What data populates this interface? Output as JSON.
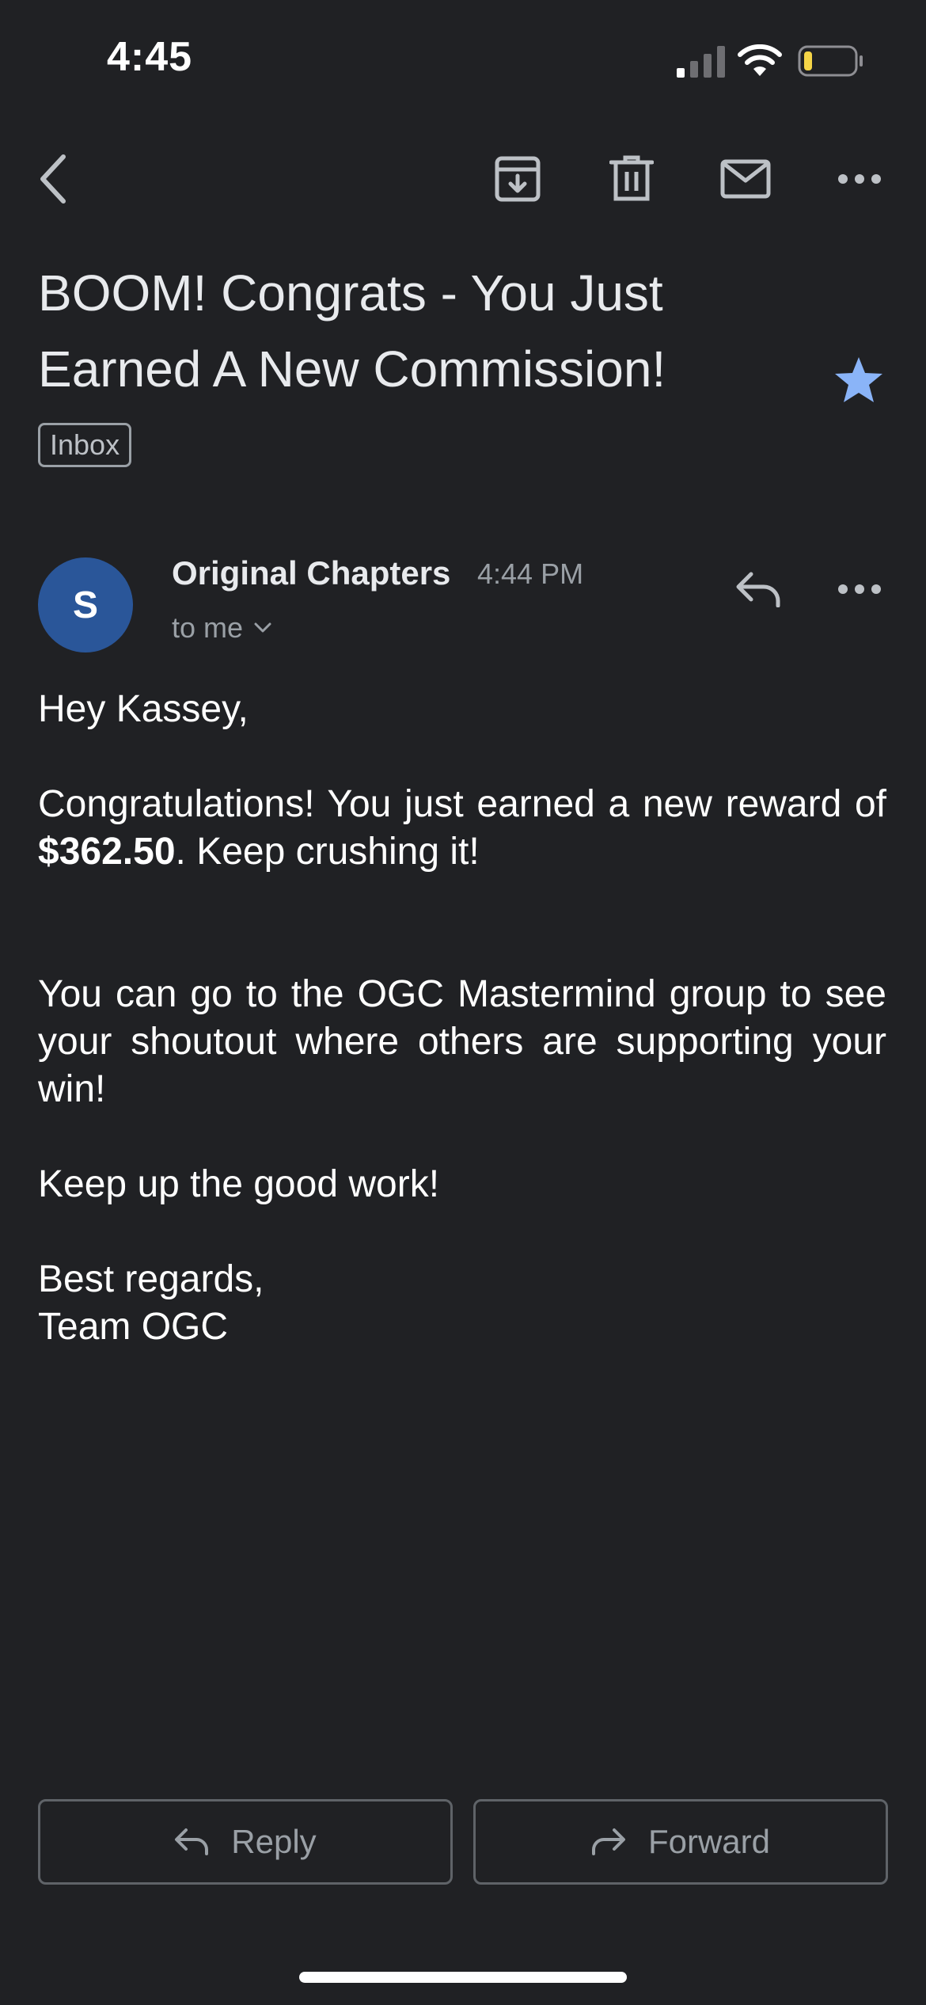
{
  "status_bar": {
    "time": "4:45"
  },
  "toolbar": {
    "back": "chevron-left-icon",
    "archive": "archive-icon",
    "delete": "trash-icon",
    "mark_unread": "mail-icon",
    "more": "more-horizontal-icon"
  },
  "email": {
    "subject_line1": "BOOM! Congrats - You Just",
    "subject_line2": "Earned A New Commission!",
    "label": "Inbox",
    "starred": true,
    "sender": {
      "initial": "S",
      "name": "Original Chapters",
      "time": "4:44 PM",
      "recipient": "to me"
    },
    "body": {
      "greeting": "Hey Kassey,",
      "para1_start": "Congratulations! You just earned a new reward of ",
      "amount": "$362.50",
      "para1_end": ". Keep crushing it!",
      "para2": "You can go to the OGC Mastermind group to see your shoutout where others are supporting your win!",
      "para3": "Keep up the good work!",
      "signoff": "Best regards,",
      "signature": "Team OGC"
    }
  },
  "actions": {
    "reply": "Reply",
    "forward": "Forward"
  },
  "colors": {
    "background": "#202124",
    "star": "#8ab4f8",
    "avatar": "#2a5699",
    "battery_level": "#f5d547"
  }
}
